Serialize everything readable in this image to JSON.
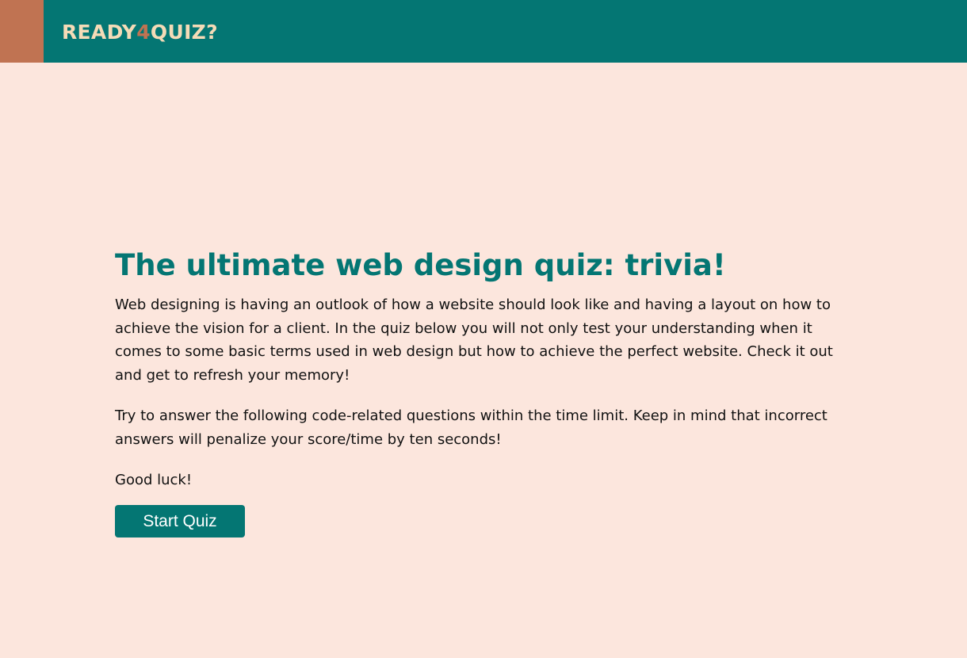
{
  "header": {
    "logo": {
      "part1": "READY",
      "part2": "4",
      "part3": "QUIZ?"
    },
    "colors": {
      "bar": "#047673",
      "accent_block": "#c07352",
      "logo_text": "#f4dbb7",
      "logo_number": "#c07352"
    }
  },
  "main": {
    "title": "The ultimate web design quiz: trivia!",
    "intro": "Web designing is having an outlook of how a website should look like and having a layout on how to achieve the vision for a client. In the quiz below you will not only test your understanding when it comes to some basic terms used in web design but how to achieve the perfect website. Check it out and get to refresh your memory!",
    "rules": "Try to answer the following code-related questions within the time limit. Keep in mind that incorrect answers will penalize your score/time by ten seconds!",
    "luck": "Good luck!",
    "start_button": "Start Quiz"
  },
  "colors": {
    "page_background": "#fce6dd",
    "title": "#047673",
    "button": "#047673"
  }
}
